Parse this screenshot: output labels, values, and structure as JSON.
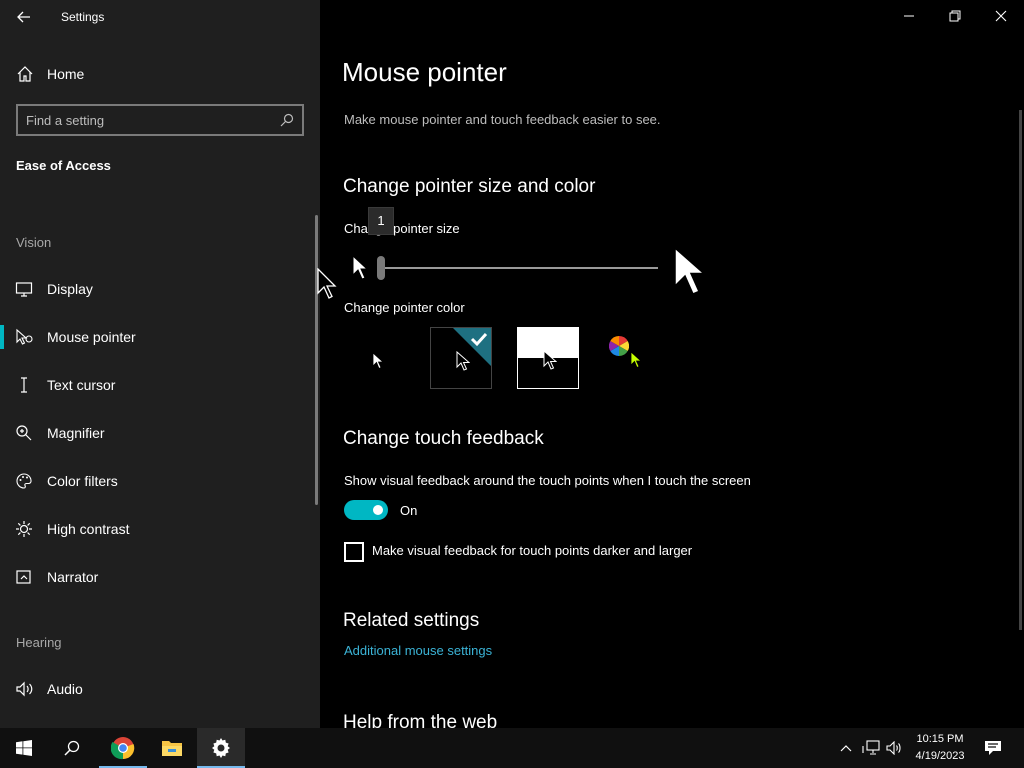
{
  "app": {
    "title": "Settings"
  },
  "sidebar": {
    "home_label": "Home",
    "search_placeholder": "Find a setting",
    "section_title": "Ease of Access",
    "groups": {
      "vision": "Vision",
      "hearing": "Hearing"
    },
    "items": [
      {
        "label": "Display",
        "icon": "monitor-icon"
      },
      {
        "label": "Mouse pointer",
        "icon": "mouse-pointer-icon",
        "active": true
      },
      {
        "label": "Text cursor",
        "icon": "text-cursor-icon"
      },
      {
        "label": "Magnifier",
        "icon": "magnifier-icon"
      },
      {
        "label": "Color filters",
        "icon": "palette-icon"
      },
      {
        "label": "High contrast",
        "icon": "sun-icon"
      },
      {
        "label": "Narrator",
        "icon": "narrator-icon"
      },
      {
        "label": "Audio",
        "icon": "speaker-icon"
      }
    ]
  },
  "main": {
    "title": "Mouse pointer",
    "description": "Make mouse pointer and touch feedback easier to see.",
    "size_color": {
      "heading": "Change pointer size and color",
      "size_label": "Change pointer size",
      "size_value": "1",
      "color_label": "Change pointer color",
      "color_options": [
        "white",
        "black",
        "inverted",
        "custom"
      ],
      "selected_color": "black"
    },
    "touch": {
      "heading": "Change touch feedback",
      "feedback_label": "Show visual feedback around the touch points when I touch the screen",
      "toggle_state": "On",
      "checkbox_label": "Make visual feedback for touch points darker and larger",
      "checkbox_checked": false
    },
    "related": {
      "heading": "Related settings",
      "link": "Additional mouse settings"
    },
    "help": {
      "heading": "Help from the web"
    }
  },
  "taskbar": {
    "time": "10:15 PM",
    "date": "4/19/2023"
  },
  "colors": {
    "accent": "#00b7c3",
    "link": "#3bb3d6",
    "sidebar_bg": "#1f1f1f"
  }
}
